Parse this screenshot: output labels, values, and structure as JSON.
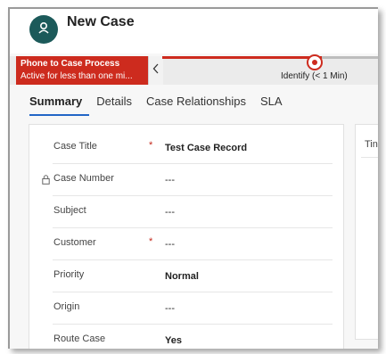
{
  "header": {
    "title": "New Case",
    "avatar_icon": "user-icon",
    "avatar_color": "#1c5a5a"
  },
  "process": {
    "active_stage_title": "Phone to Case Process",
    "active_stage_subtitle": "Active for less than one mi...",
    "current_stage_label": "Identify  (< 1 Min)",
    "accent_color": "#cd2b1e"
  },
  "tabs": [
    {
      "label": "Summary",
      "active": true
    },
    {
      "label": "Details",
      "active": false
    },
    {
      "label": "Case Relationships",
      "active": false
    },
    {
      "label": "SLA",
      "active": false
    }
  ],
  "form": {
    "fields": [
      {
        "label": "Case Title",
        "required": "*",
        "value": "Test Case Record"
      },
      {
        "label": "Case Number",
        "locked": true,
        "value": "---"
      },
      {
        "label": "Subject",
        "value": "---"
      },
      {
        "label": "Customer",
        "required": "*",
        "value": "---"
      },
      {
        "label": "Priority",
        "value": "Normal"
      },
      {
        "label": "Origin",
        "value": "---"
      },
      {
        "label": "Route Case",
        "value": "Yes"
      }
    ]
  },
  "side_panel": {
    "title_fragment": "Tin"
  }
}
